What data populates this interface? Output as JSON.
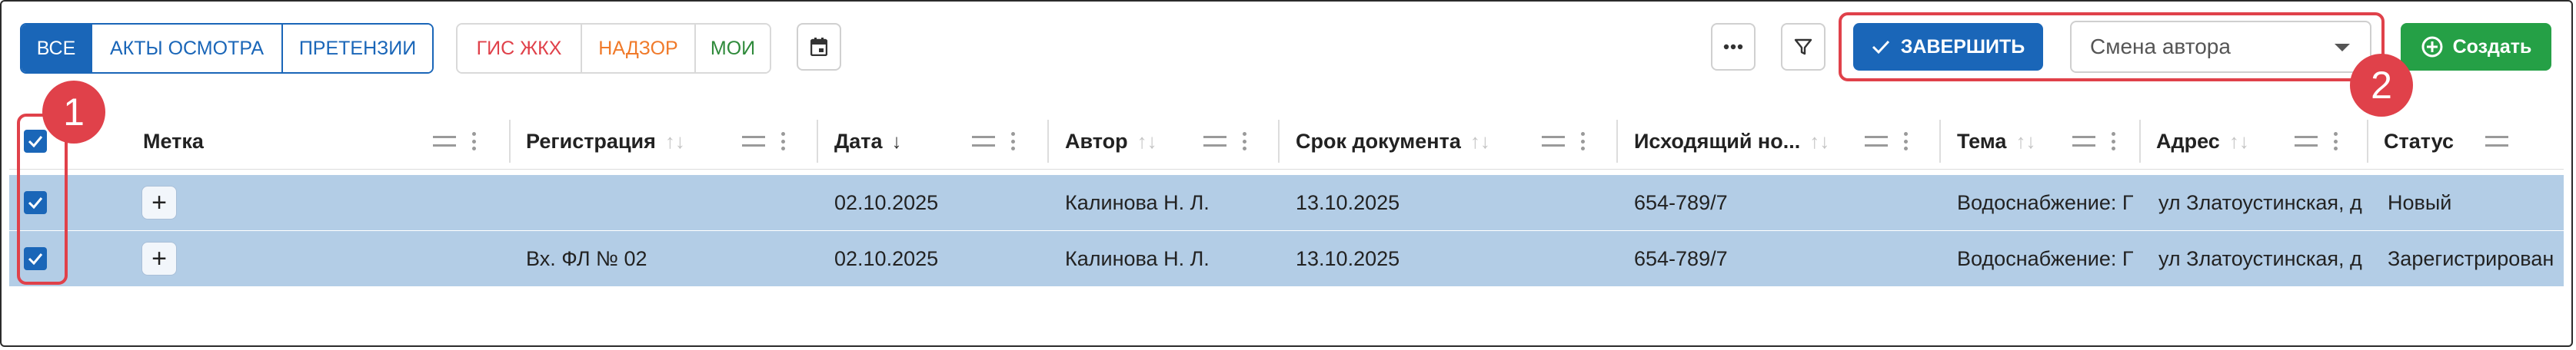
{
  "filters": {
    "primary_group": [
      "ВСЕ",
      "АКТЫ ОСМОТРА",
      "ПРЕТЕНЗИИ"
    ],
    "secondary_group": [
      {
        "label": "ГИС ЖКХ",
        "color": "#e0414a"
      },
      {
        "label": "НАДЗОР",
        "color": "#f07a2a"
      },
      {
        "label": "МОИ",
        "color": "#2f8a3b"
      }
    ],
    "active_index": 0
  },
  "toolbar": {
    "complete_label": "ЗАВЕРШИТЬ",
    "author_select_placeholder": "Смена автора",
    "create_label": "Создать"
  },
  "annotations": [
    "1",
    "2"
  ],
  "table": {
    "columns": [
      {
        "label": "Метка",
        "sort": "none"
      },
      {
        "label": "Регистрация",
        "sort": "both"
      },
      {
        "label": "Дата",
        "sort": "desc"
      },
      {
        "label": "Автор",
        "sort": "both"
      },
      {
        "label": "Срок документа",
        "sort": "both"
      },
      {
        "label": "Исходящий но...",
        "sort": "both"
      },
      {
        "label": "Тема",
        "sort": "both"
      },
      {
        "label": "Адрес",
        "sort": "both"
      },
      {
        "label": "Статус",
        "sort": "none"
      }
    ],
    "rows": [
      {
        "checked": true,
        "mark": "+",
        "registration": "",
        "date": "02.10.2025",
        "author": "Калинова Н. Л.",
        "deadline": "13.10.2025",
        "outgoing": "654-789/7",
        "topic": "Водоснабжение: Г",
        "address": "ул Златоустинская, д",
        "status": "Новый"
      },
      {
        "checked": true,
        "mark": "+",
        "registration": "Вх. ФЛ № 02",
        "date": "02.10.2025",
        "author": "Калинова Н. Л.",
        "deadline": "13.10.2025",
        "outgoing": "654-789/7",
        "topic": "Водоснабжение: Г",
        "address": "ул Златоустинская, д",
        "status": "Зарегистрирован"
      }
    ]
  },
  "colors": {
    "accent": "#1a66b8",
    "create_green": "#25a046",
    "selected_row": "#b3cde6",
    "annotation_red": "#e0414a"
  }
}
